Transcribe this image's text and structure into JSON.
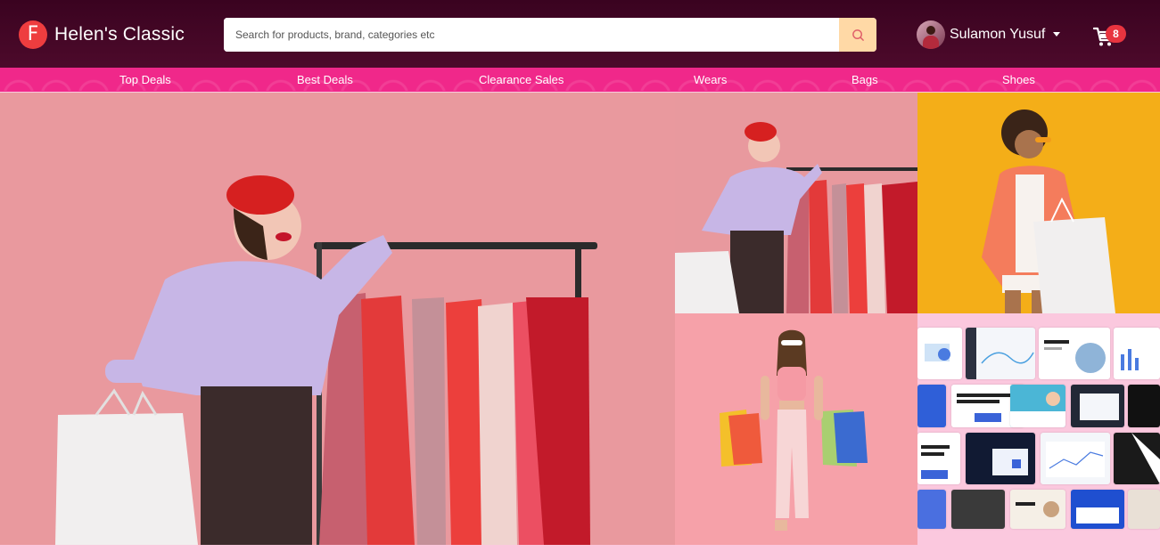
{
  "brand": {
    "logo_letter": "F",
    "name": "Helen's Classic"
  },
  "search": {
    "placeholder": "Search for products, brand, categories etc",
    "icon": "search-icon"
  },
  "user": {
    "name": "Sulamon Yusuf",
    "avatar_icon": "avatar",
    "menu_icon": "caret-down-icon"
  },
  "cart": {
    "icon": "cart-icon",
    "count": "8"
  },
  "nav": {
    "items": [
      {
        "label": "Top Deals"
      },
      {
        "label": "Best Deals"
      },
      {
        "label": "Clearance Sales"
      },
      {
        "label": "Wears"
      },
      {
        "label": "Bags"
      },
      {
        "label": "Shoes"
      }
    ]
  },
  "colors": {
    "header_bg": "#3a0320",
    "nav_bg": "#f0288a",
    "logo": "#ee3d3f",
    "search_button": "#ffd9a6",
    "badge": "#e8343f",
    "page_bg": "#fbc8de"
  }
}
